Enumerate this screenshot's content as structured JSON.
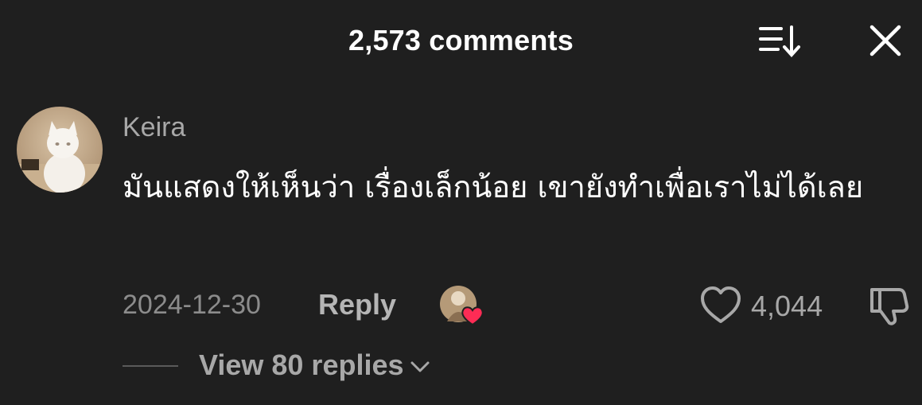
{
  "header": {
    "title": "2,573 comments",
    "sort_icon": "sort-descending-icon",
    "close_icon": "close-icon"
  },
  "comment": {
    "username": "Keira",
    "text": "มันแสดงให้เห็นว่า เรื่องเล็กน้อย เขายังทำเพื่อเราไม่ได้เลย",
    "date": "2024-12-30",
    "reply_label": "Reply",
    "like_count": "4,044",
    "icons": {
      "like": "heart-icon",
      "dislike": "thumbs-down-icon",
      "creator_liked": "creator-liked-heart-icon"
    }
  },
  "replies": {
    "label": "View 80 replies",
    "icon": "chevron-down-icon"
  },
  "colors": {
    "background": "#1f1f1f",
    "primary_text": "#ffffff",
    "secondary_text": "#a8a8a8",
    "heart_badge": "#fe2c55"
  }
}
